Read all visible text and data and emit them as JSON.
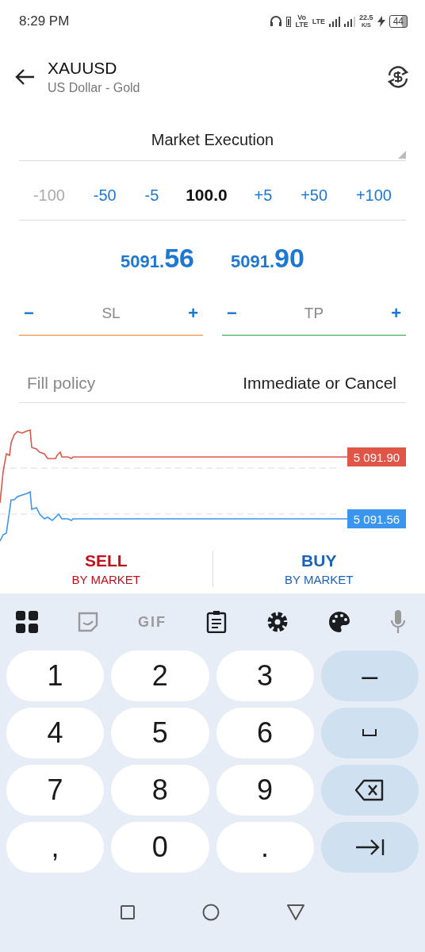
{
  "status_bar": {
    "time": "8:29 PM",
    "volte_top": "Vo",
    "volte_bottom": "LTE",
    "lte": "LTE",
    "speed": "22.5",
    "speed_unit": "K/S",
    "battery": "44"
  },
  "header": {
    "symbol": "XAUUSD",
    "description": "US Dollar - Gold"
  },
  "order_type": {
    "value": "Market Execution"
  },
  "volume": {
    "steps": [
      {
        "label": "-100",
        "kind": "step",
        "disabled": true
      },
      {
        "label": "-50",
        "kind": "step",
        "disabled": false
      },
      {
        "label": "-5",
        "kind": "step",
        "disabled": false
      },
      {
        "label": "100.0",
        "kind": "value"
      },
      {
        "label": "+5",
        "kind": "step",
        "disabled": false
      },
      {
        "label": "+50",
        "kind": "step",
        "disabled": false
      },
      {
        "label": "+100",
        "kind": "step",
        "disabled": false
      }
    ]
  },
  "prices": [
    {
      "main": "5091.",
      "big": "56"
    },
    {
      "main": "5091.",
      "big": "90"
    }
  ],
  "stops": [
    {
      "minus": "−",
      "label": "SL",
      "plus": "+",
      "color": "#e8832a"
    },
    {
      "minus": "−",
      "label": "TP",
      "plus": "+",
      "color": "#2ea043"
    }
  ],
  "fill_policy": {
    "label": "Fill policy",
    "value": "Immediate or Cancel"
  },
  "chart": {
    "lines": [
      {
        "price": "5 091.90",
        "color": "#df5648"
      },
      {
        "price": "5 091.56",
        "color": "#3b95ee"
      }
    ]
  },
  "actions": [
    {
      "title": "SELL",
      "subtitle": "BY MARKET",
      "kind": "sell"
    },
    {
      "title": "BUY",
      "subtitle": "BY MARKET",
      "kind": "buy"
    }
  ],
  "keyboard": {
    "gif": "GIF",
    "rows": [
      [
        {
          "label": "1",
          "kind": "text"
        },
        {
          "label": "2",
          "kind": "text"
        },
        {
          "label": "3",
          "kind": "text"
        },
        {
          "label": "–",
          "kind": "action"
        }
      ],
      [
        {
          "label": "4",
          "kind": "text"
        },
        {
          "label": "5",
          "kind": "text"
        },
        {
          "label": "6",
          "kind": "text"
        },
        {
          "kind": "space"
        }
      ],
      [
        {
          "label": "7",
          "kind": "text"
        },
        {
          "label": "8",
          "kind": "text"
        },
        {
          "label": "9",
          "kind": "text"
        },
        {
          "kind": "backspace"
        }
      ],
      [
        {
          "label": ",",
          "kind": "text"
        },
        {
          "label": "0",
          "kind": "text"
        },
        {
          "label": ".",
          "kind": "text"
        },
        {
          "kind": "next"
        }
      ]
    ]
  }
}
